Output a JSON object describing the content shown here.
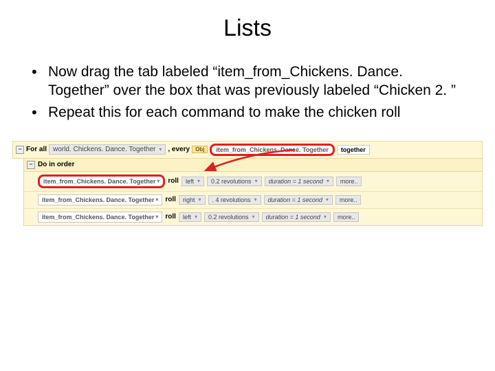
{
  "title": "Lists",
  "bullets": [
    "Now drag the tab labeled “item_from_Chickens. Dance. Together” over the box that was previously labeled “Chicken 2. ”",
    "Repeat this for each command to make the chicken roll"
  ],
  "alice": {
    "forall": "For all",
    "list_param": "world. Chickens. Dance. Together",
    "every": ", every",
    "obj_badge": "Obj",
    "item_tile": "item_from_Chickens. Dance. Together",
    "together": "together",
    "do_in_order": "Do in order",
    "rows": [
      {
        "target": "item_from_Chickens. Dance. Together",
        "highlighted": true,
        "action": "roll",
        "dir": "left",
        "amt": "0.2 revolutions",
        "dur": "duration = 1 second",
        "more": "more.."
      },
      {
        "target": "item_from_Chickens. Dance. Together",
        "highlighted": false,
        "action": "roll",
        "dir": "right",
        "amt": ". 4 revolutions",
        "dur": "duration = 1 second",
        "more": "more.."
      },
      {
        "target": "item_from_Chickens. Dance. Together",
        "highlighted": false,
        "action": "roll",
        "dir": "left",
        "amt": "0.2 revolutions",
        "dur": "duration = 1 second",
        "more": "more.."
      }
    ]
  }
}
